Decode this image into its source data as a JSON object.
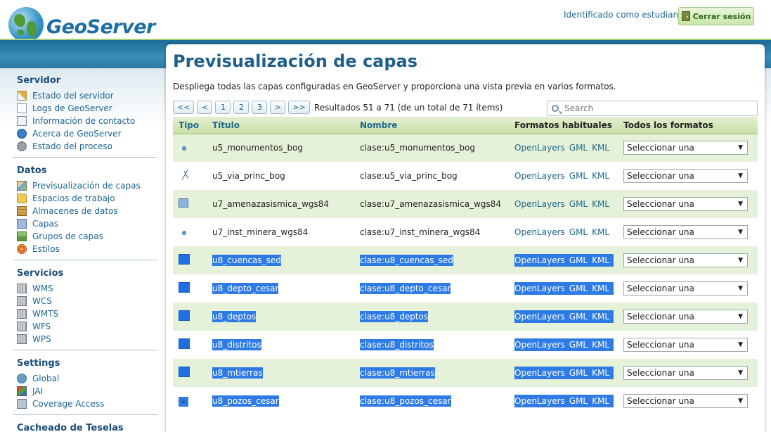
{
  "header": {
    "app_name": "GeoServer",
    "user_text": "Identificado como estudiante.",
    "logout_label": "Cerrar sesión"
  },
  "sidebar": {
    "sections": [
      {
        "title": "Servidor",
        "items": [
          {
            "label": "Estado del servidor",
            "icon": "warning-icon"
          },
          {
            "label": "Logs de GeoServer",
            "icon": "document-icon"
          },
          {
            "label": "Información de contacto",
            "icon": "contact-card-icon"
          },
          {
            "label": "Acerca de GeoServer",
            "icon": "help-icon"
          },
          {
            "label": "Estado del proceso",
            "icon": "gear-icon"
          }
        ]
      },
      {
        "title": "Datos",
        "items": [
          {
            "label": "Previsualización de capas",
            "icon": "map-icon"
          },
          {
            "label": "Espacios de trabajo",
            "icon": "folder-icon"
          },
          {
            "label": "Almacenes de datos",
            "icon": "database-icon"
          },
          {
            "label": "Capas",
            "icon": "layer-icon"
          },
          {
            "label": "Grupos de capas",
            "icon": "layer-group-icon"
          },
          {
            "label": "Estilos",
            "icon": "style-icon"
          }
        ]
      },
      {
        "title": "Servicios",
        "items": [
          {
            "label": "WMS",
            "icon": "service-icon"
          },
          {
            "label": "WCS",
            "icon": "service-icon"
          },
          {
            "label": "WMTS",
            "icon": "service-icon"
          },
          {
            "label": "WFS",
            "icon": "service-icon"
          },
          {
            "label": "WPS",
            "icon": "service-icon"
          }
        ]
      },
      {
        "title": "Settings",
        "items": [
          {
            "label": "Global",
            "icon": "globe-icon"
          },
          {
            "label": "JAI",
            "icon": "jai-icon"
          },
          {
            "label": "Coverage Access",
            "icon": "coverage-icon"
          }
        ]
      },
      {
        "title": "Cacheado de Teselas",
        "items": []
      }
    ]
  },
  "main": {
    "title": "Previsualización de capas",
    "description": "Despliega todas las capas configuradas en GeoServer y proporciona una vista previa en varios formatos.",
    "pager": {
      "first": "<<",
      "prev": "<",
      "pages": [
        "1",
        "2",
        "3"
      ],
      "next": ">",
      "last": ">>",
      "info": "Resultados 51 a 71 (de un total de 71 ítems)"
    },
    "search_placeholder": "Search",
    "columns": {
      "type": "Tipo",
      "title": "Título",
      "name": "Nombre",
      "common_formats": "Formatos habituales",
      "all_formats": "Todos los formatos"
    },
    "formats": [
      "OpenLayers",
      "GML",
      "KML"
    ],
    "select_label": "Seleccionar una",
    "rows": [
      {
        "type": "point",
        "title": "u5_monumentos_bog",
        "name": "clase:u5_monumentos_bog",
        "selected": false
      },
      {
        "type": "line",
        "title": "u5_via_princ_bog",
        "name": "clase:u5_via_princ_bog",
        "selected": false
      },
      {
        "type": "polygon",
        "title": "u7_amenazasismica_wgs84",
        "name": "clase:u7_amenazasismica_wgs84",
        "selected": false
      },
      {
        "type": "point",
        "title": "u7_inst_minera_wgs84",
        "name": "clase:u7_inst_minera_wgs84",
        "selected": false
      },
      {
        "type": "polygon",
        "title": "u8_cuencas_sed",
        "name": "clase:u8_cuencas_sed",
        "selected": true
      },
      {
        "type": "polygon",
        "title": "u8_depto_cesar",
        "name": "clase:u8_depto_cesar",
        "selected": true
      },
      {
        "type": "polygon",
        "title": "u8_deptos",
        "name": "clase:u8_deptos",
        "selected": true
      },
      {
        "type": "polygon",
        "title": "u8_distritos",
        "name": "clase:u8_distritos",
        "selected": true
      },
      {
        "type": "polygon",
        "title": "u8_mtierras",
        "name": "clase:u8_mtierras",
        "selected": true
      },
      {
        "type": "point",
        "title": "u8_pozos_cesar",
        "name": "clase:u8_pozos_cesar",
        "selected": true
      }
    ]
  },
  "colors": {
    "accent": "#1f5f8b",
    "header_band": "#2a7aa5",
    "row_alt": "#e5f1d8",
    "selection": "#2f7be6"
  }
}
